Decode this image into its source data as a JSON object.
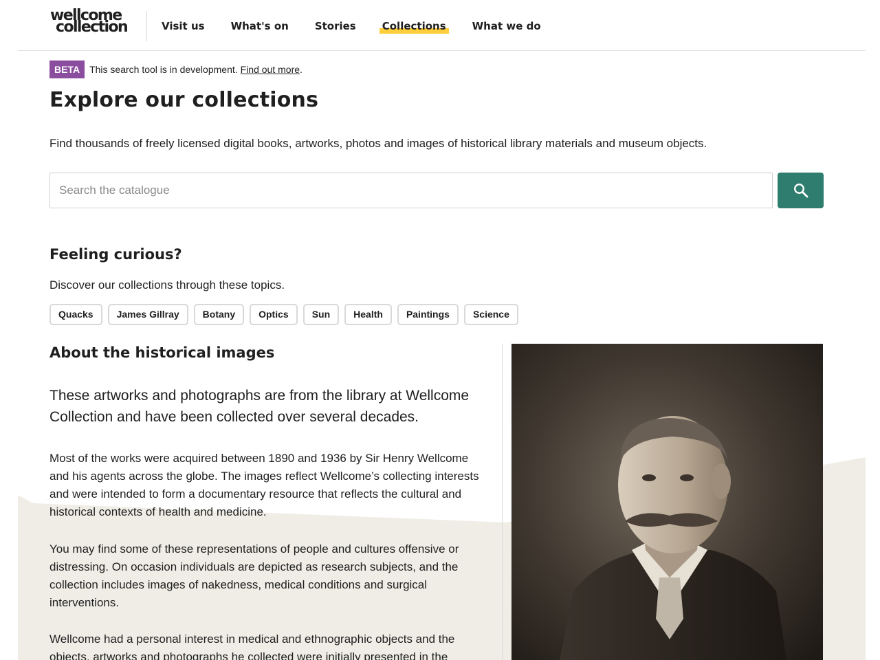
{
  "header": {
    "logo_line1": "wellcome",
    "logo_line2": "collection",
    "nav": [
      {
        "label": "Visit us"
      },
      {
        "label": "What's on"
      },
      {
        "label": "Stories"
      },
      {
        "label": "Collections",
        "active": true
      },
      {
        "label": "What we do"
      }
    ]
  },
  "beta": {
    "badge": "BETA",
    "text": "This search tool is in development.",
    "link": "Find out more",
    "suffix": "."
  },
  "page_title": "Explore our collections",
  "intro": "Find thousands of freely licensed digital books, artworks, photos and images of historical library materials and museum objects.",
  "search": {
    "placeholder": "Search the catalogue",
    "button_icon": "search-icon"
  },
  "curious": {
    "title": "Feeling curious?",
    "text": "Discover our collections through these topics.",
    "topics": [
      "Quacks",
      "James Gillray",
      "Botany",
      "Optics",
      "Sun",
      "Health",
      "Paintings",
      "Science"
    ]
  },
  "about": {
    "title": "About the historical images",
    "lead": "These artworks and photographs are from the library at Wellcome Collection and have been collected over several decades.",
    "paragraphs": [
      "Most of the works were acquired between 1890 and 1936 by Sir Henry Wellcome and his agents across the globe. The images reflect Wellcome’s collecting interests and were intended to form a documentary resource that reflects the cultural and historical contexts of health and medicine.",
      "You may find some of these representations of people and cultures offensive or distressing. On occasion individuals are depicted as research subjects, and the collection includes images of nakedness, medical conditions and surgical interventions.",
      "Wellcome had a personal interest in medical and ethnographic objects and the objects, artworks and photographs he collected were initially presented in the"
    ]
  },
  "colors": {
    "beta_purple": "#8b4e9f",
    "active_underline": "#ffce3c",
    "search_button": "#2e7d6e",
    "background_shape": "#efede5"
  }
}
